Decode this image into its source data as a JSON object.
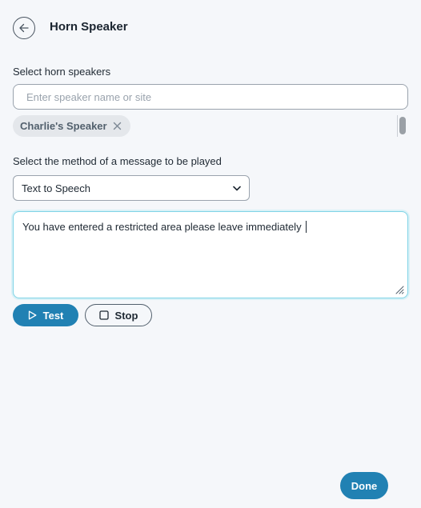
{
  "header": {
    "title": "Horn Speaker",
    "back_icon": "arrow-left-icon"
  },
  "speakers": {
    "label": "Select horn speakers",
    "placeholder": "Enter speaker name or site",
    "value": "",
    "selected": [
      {
        "name": "Charlie's Speaker",
        "remove_icon": "close-icon"
      }
    ]
  },
  "method": {
    "label": "Select the method of a message to be played",
    "selected": "Text to Speech",
    "arrow_icon": "chevron-down-icon"
  },
  "message": {
    "text": "You have entered a restricted area please leave immediately"
  },
  "actions": {
    "test_label": "Test",
    "test_icon": "play-icon",
    "stop_label": "Stop",
    "stop_icon": "stop-icon"
  },
  "footer": {
    "done_label": "Done"
  },
  "colors": {
    "accent": "#2181b3",
    "background": "#f5f7fa",
    "focus_border": "#7fd3e6"
  }
}
